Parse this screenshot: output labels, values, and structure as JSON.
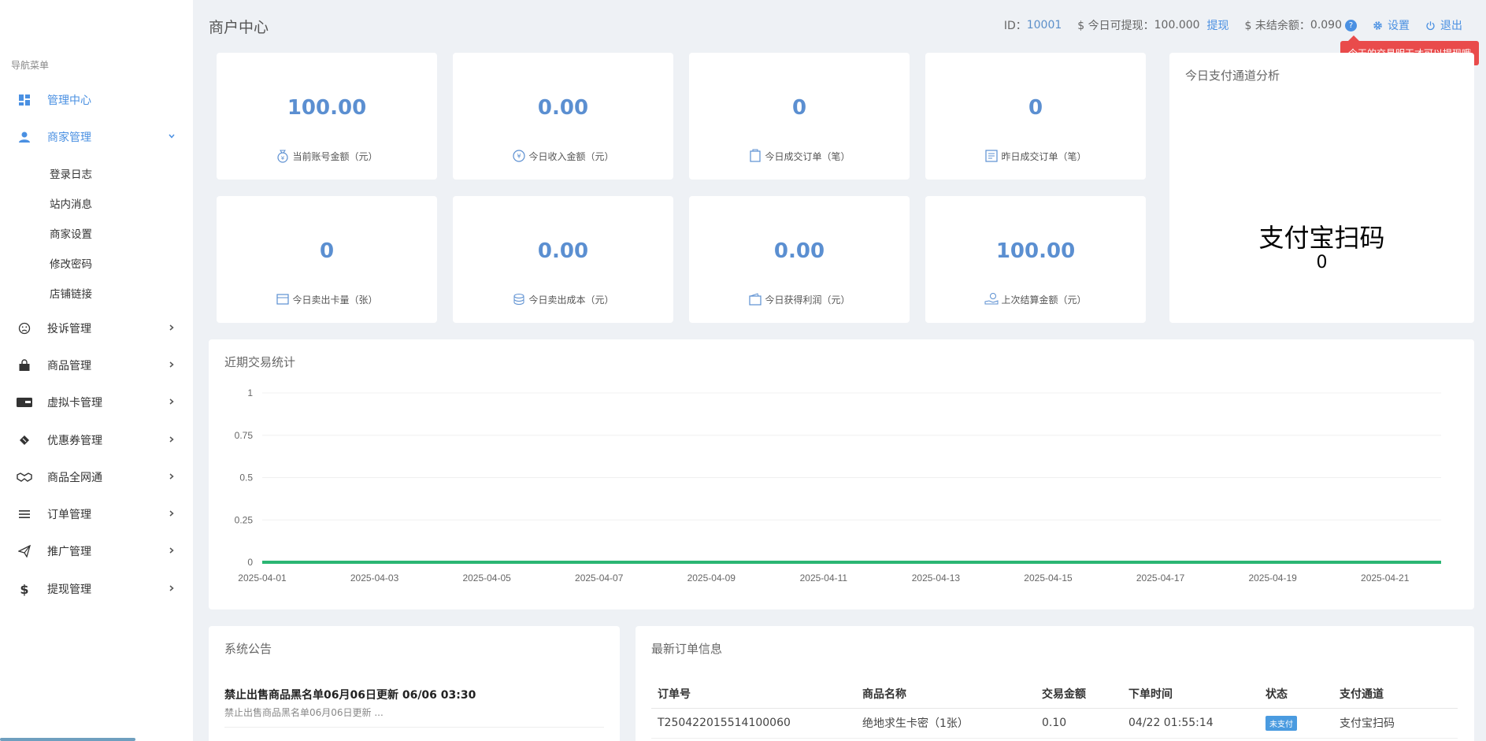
{
  "header": {
    "title": "商户中心",
    "id_label": "ID：",
    "id_value": "10001",
    "withdraw_label": "$ 今日可提现：",
    "withdraw_value": "100.000",
    "withdraw_link": "提现",
    "unsettled_label": "$ 未结余额：",
    "unsettled_value": "0.090",
    "help_glyph": "?",
    "settings_label": "设置",
    "logout_label": "退出",
    "tooltip": "今天的交易明天才可以提现哦"
  },
  "sidebar": {
    "title": "导航菜单",
    "items": [
      {
        "label": "管理中心",
        "icon": "dashboard-icon"
      },
      {
        "label": "商家管理",
        "icon": "user-icon"
      },
      {
        "label": "投诉管理",
        "icon": "frown-icon"
      },
      {
        "label": "商品管理",
        "icon": "shopping-bag-icon"
      },
      {
        "label": "虚拟卡管理",
        "icon": "card-icon"
      },
      {
        "label": "优惠券管理",
        "icon": "ticket-icon"
      },
      {
        "label": "商品全网通",
        "icon": "handshake-icon"
      },
      {
        "label": "订单管理",
        "icon": "list-icon"
      },
      {
        "label": "推广管理",
        "icon": "paper-plane-icon"
      },
      {
        "label": "提现管理",
        "icon": "dollar-icon"
      }
    ],
    "subitems": [
      "登录日志",
      "站内消息",
      "商家设置",
      "修改密码",
      "店铺链接"
    ]
  },
  "stats": [
    {
      "value": "100.00",
      "label": "当前账号金额（元）",
      "icon": "money-bag-icon"
    },
    {
      "value": "0.00",
      "label": "今日收入金额（元）",
      "icon": "income-icon"
    },
    {
      "value": "0",
      "label": "今日成交订单（笔）",
      "icon": "order-icon"
    },
    {
      "value": "0",
      "label": "昨日成交订单（笔）",
      "icon": "receipt-icon"
    },
    {
      "value": "0",
      "label": "今日卖出卡量（张）",
      "icon": "card-sold-icon"
    },
    {
      "value": "0.00",
      "label": "今日卖出成本（元）",
      "icon": "coins-icon"
    },
    {
      "value": "0.00",
      "label": "今日获得利润（元）",
      "icon": "wallet-icon"
    },
    {
      "value": "100.00",
      "label": "上次结算金额（元）",
      "icon": "hand-coin-icon"
    }
  ],
  "channel_panel": {
    "title": "今日支付通道分析",
    "channel": "支付宝扫码",
    "value": "0"
  },
  "chart_panel": {
    "title": "近期交易统计"
  },
  "chart_data": {
    "type": "line",
    "xlabel": "",
    "ylabel": "",
    "ylim": [
      0,
      1
    ],
    "yticks": [
      "0",
      "0.25",
      "0.5",
      "0.75",
      "1"
    ],
    "x": [
      "2025-04-01",
      "2025-04-02",
      "2025-04-03",
      "2025-04-04",
      "2025-04-05",
      "2025-04-06",
      "2025-04-07",
      "2025-04-08",
      "2025-04-09",
      "2025-04-10",
      "2025-04-11",
      "2025-04-12",
      "2025-04-13",
      "2025-04-14",
      "2025-04-15",
      "2025-04-16",
      "2025-04-17",
      "2025-04-18",
      "2025-04-19",
      "2025-04-20",
      "2025-04-21",
      "2025-04-22"
    ],
    "xtick_labels": [
      "2025-04-01",
      "2025-04-03",
      "2025-04-05",
      "2025-04-07",
      "2025-04-09",
      "2025-04-11",
      "2025-04-13",
      "2025-04-15",
      "2025-04-17",
      "2025-04-19",
      "2025-04-21"
    ],
    "series": [
      {
        "values": [
          0,
          0,
          0,
          0,
          0,
          0,
          0,
          0,
          0,
          0,
          0,
          0,
          0,
          0,
          0,
          0,
          0,
          0,
          0,
          0,
          0,
          0
        ],
        "color": "#2bb673"
      }
    ],
    "grid": true
  },
  "announcement": {
    "title": "系统公告",
    "items": [
      {
        "title": "禁止出售商品黑名单06月06日更新 06/06 03:30",
        "desc": "禁止出售商品黑名单06月06日更新 ..."
      }
    ]
  },
  "orders": {
    "title": "最新订单信息",
    "columns": [
      "订单号",
      "商品名称",
      "交易金额",
      "下单时间",
      "状态",
      "支付通道"
    ],
    "rows": [
      {
        "order_no": "T250422015514100060",
        "product": "绝地求生卡密（1张）",
        "amount": "0.10",
        "time": "04/22 01:55:14",
        "status": "未支付",
        "channel": "支付宝扫码"
      }
    ]
  },
  "colors": {
    "accent": "#4a90e2",
    "stat_value": "#5b8fd1",
    "tooltip_bg": "#e94b4b",
    "line": "#2bb673"
  }
}
